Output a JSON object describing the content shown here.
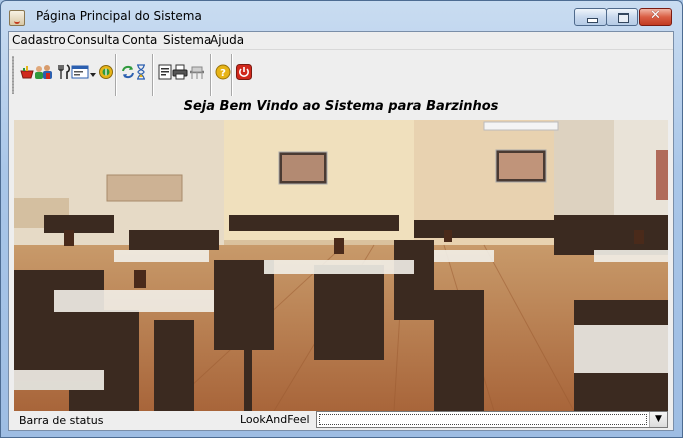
{
  "window": {
    "title": "Página Principal do Sistema",
    "close_glyph": "✕"
  },
  "menubar": {
    "items": [
      "Cadastro",
      "Consulta",
      "Conta",
      "Sistema",
      "Ajuda"
    ]
  },
  "toolbar": {
    "icons": [
      "food-icon",
      "users-icon",
      "cutlery-icon",
      "form-icon",
      "dropdown-icon",
      "money-icon",
      "refresh-icon",
      "hourglass-icon",
      "report-icon",
      "printer-icon",
      "chair-icon",
      "help-icon",
      "power-icon"
    ],
    "colors": {
      "red": "#d0281c",
      "green": "#2f9a3d",
      "blue": "#2b5fb0",
      "gold": "#e7b417"
    }
  },
  "banner": {
    "welcome": "Seja Bem Vindo ao Sistema para Barzinhos"
  },
  "background_image": {
    "subject": "restaurant-dining-room",
    "colors": {
      "wall": "#eadcc4",
      "floor": "#b0703f",
      "furniture": "#3b2a20"
    }
  },
  "statusbar": {
    "status_text": "Barra de status",
    "laf_label": "LookAndFeel",
    "laf_value": "",
    "arrow_glyph": "▼"
  }
}
